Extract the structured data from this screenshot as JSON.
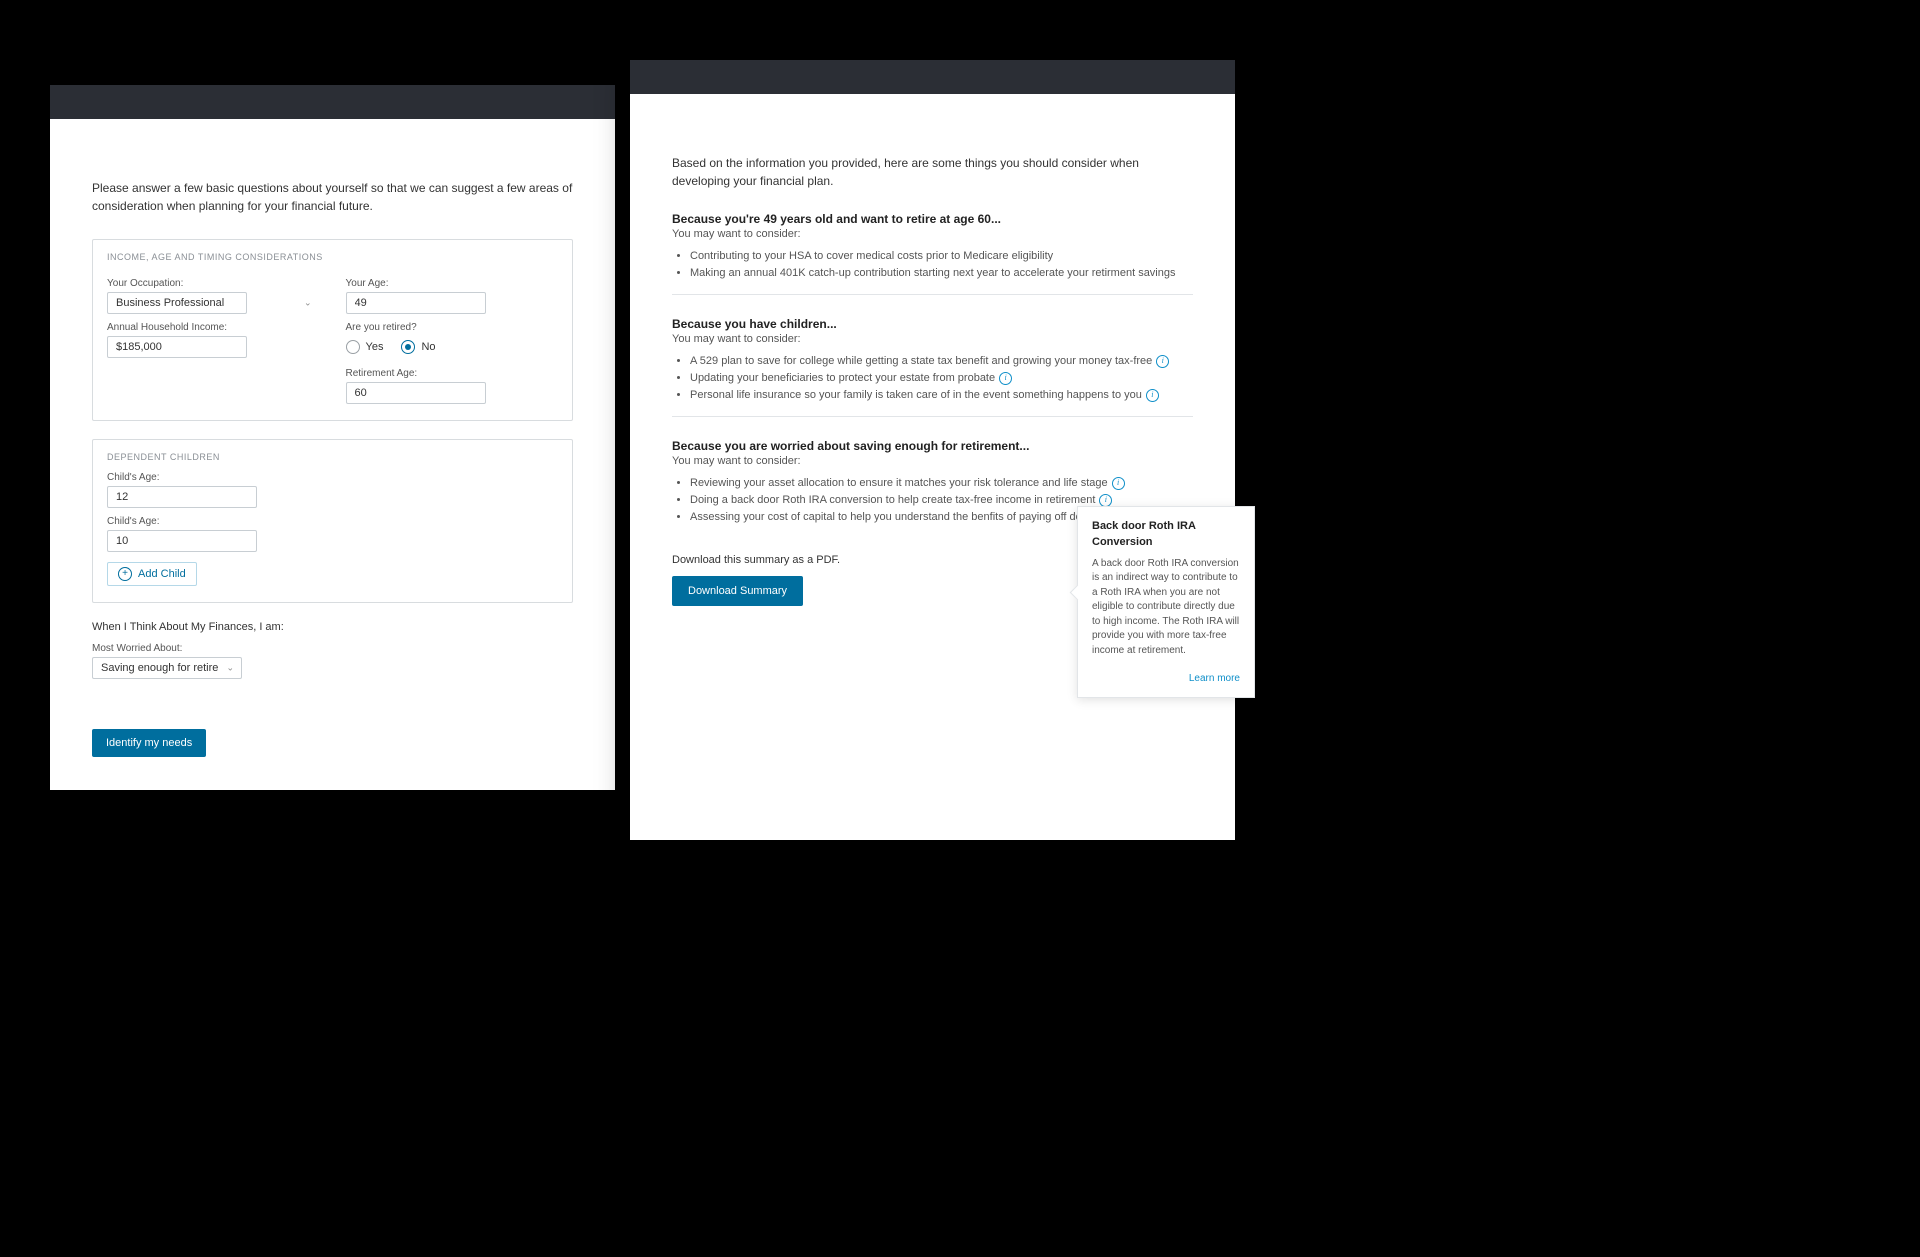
{
  "left": {
    "intro": "Please answer a few basic questions about yourself so that we can suggest a few areas of consideration when planning for your financial future.",
    "section1_title": "INCOME, AGE AND TIMING CONSIDERATIONS",
    "occupation_label": "Your Occupation:",
    "occupation_value": "Business Professional",
    "income_label": "Annual Household Income:",
    "income_value": "$185,000",
    "age_label": "Your Age:",
    "age_value": "49",
    "retired_label": "Are you retired?",
    "retired_yes": "Yes",
    "retired_no": "No",
    "retire_age_label": "Retirement Age:",
    "retire_age_value": "60",
    "section2_title": "DEPENDENT CHILDREN",
    "child_age_label": "Child's Age:",
    "child1_value": "12",
    "child2_value": "10",
    "add_child_label": "Add Child",
    "finances_heading": "When I Think About My Finances, I am:",
    "worried_label": "Most Worried About:",
    "worried_value": "Saving enough for retirement",
    "submit_label": "Identify my needs"
  },
  "right": {
    "intro": "Based on the information you provided, here are some things you should consider when developing your financial plan.",
    "s1_heading": "Because you're 49 years old and want to retire at age 60...",
    "consider_label": "You may want to consider:",
    "s1_b1": "Contributing to your HSA to cover medical costs prior to Medicare eligibility",
    "s1_b2": "Making an annual 401K catch-up contribution starting next year to accelerate your retirment savings",
    "s2_heading": "Because you have children...",
    "s2_b1": "A 529 plan to save for college while getting a state tax benefit and growing your money tax-free",
    "s2_b2": "Updating your beneficiaries to protect your estate from probate",
    "s2_b3": "Personal life insurance so your family is taken care of in the event something happens to you",
    "s3_heading": "Because you are worried about saving enough for retirement...",
    "s3_b1": "Reviewing your asset allocation to ensure it matches your risk tolerance and life stage",
    "s3_b2": "Doing a back door Roth IRA conversion to help create tax-free income in retirement",
    "s3_b3": "Assessing your cost of capital to help you understand the benfits of paying off debt vs. savi",
    "dl_text": "Download this summary as a PDF.",
    "dl_btn": "Download  Summary",
    "tooltip_title": "Back door Roth IRA Conversion",
    "tooltip_body": "A back door Roth IRA conversion is an indirect way to contribute to a Roth IRA when you are not eligible to contribute directly due to high income. The Roth IRA will provide you with more tax-free income at retirement.",
    "tooltip_link": "Learn more"
  }
}
